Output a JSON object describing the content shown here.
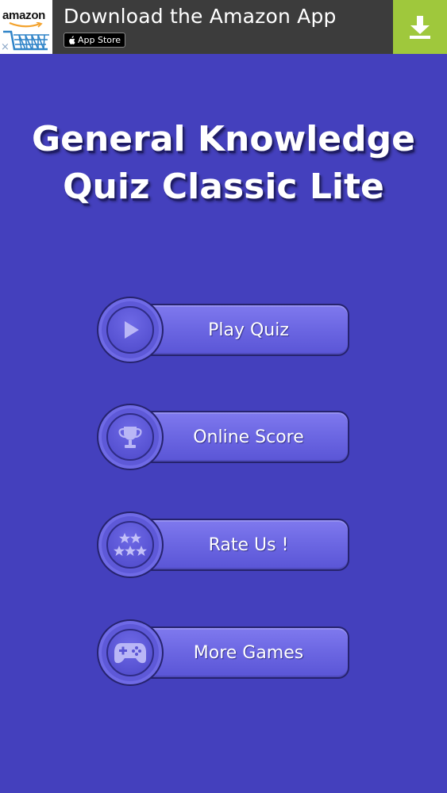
{
  "ad": {
    "logo_text": "amazon",
    "headline": "Download the Amazon App",
    "badge_label": "App Store",
    "close_symbol": "×",
    "icons": [
      "amazon-logo",
      "cart-icon",
      "apple-icon",
      "download-icon",
      "close-icon"
    ],
    "colors": {
      "download_bg": "#9fc83c",
      "banner_bg": "#3c3c3c"
    }
  },
  "title": {
    "line1": "General Knowledge",
    "line2": "Quiz Classic Lite"
  },
  "menu": [
    {
      "label": "Play Quiz",
      "icon": "play-icon"
    },
    {
      "label": "Online Score",
      "icon": "trophy-icon"
    },
    {
      "label": "Rate Us !",
      "icon": "stars-icon"
    },
    {
      "label": "More Games",
      "icon": "gamepad-icon"
    }
  ],
  "colors": {
    "background": "#4440bd",
    "button": "#6b66e2",
    "outline": "#26236e"
  }
}
